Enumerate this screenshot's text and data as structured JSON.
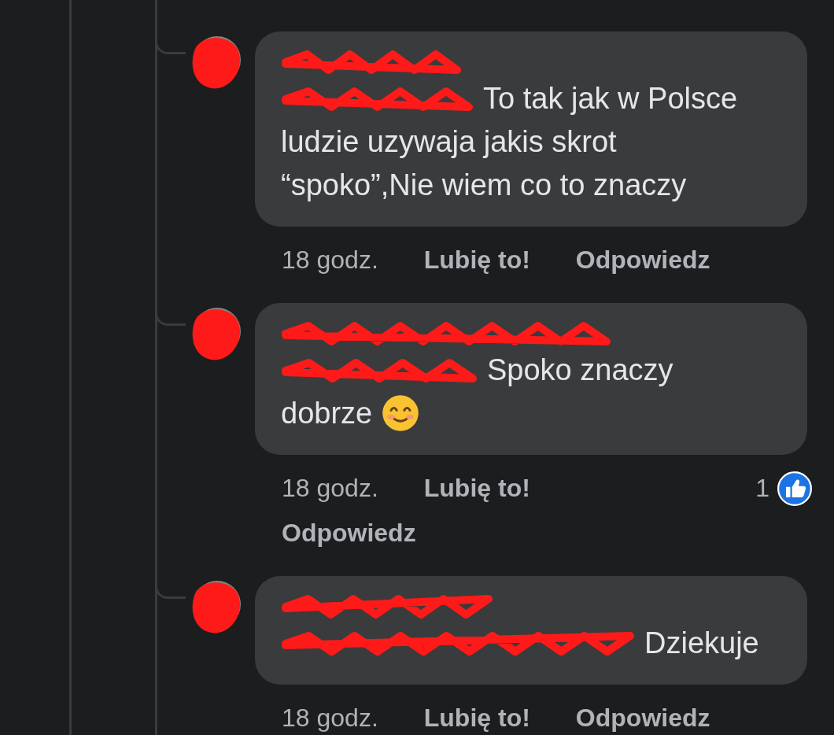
{
  "comments": [
    {
      "text": "To tak jak w Polsce ludzie uzywaja jakis skrot “spoko”,Nie wiem co to znaczy",
      "time": "18 godz.",
      "like": "Lubię to!",
      "reply": "Odpowiedz"
    },
    {
      "text": "Spoko znaczy dobrze",
      "emoji": true,
      "time": "18 godz.",
      "like": "Lubię to!",
      "reply": "Odpowiedz",
      "reactions": "1"
    },
    {
      "text": "Dziekuje",
      "time": "18 godz.",
      "like": "Lubię to!",
      "reply": "Odpowiedz"
    }
  ]
}
